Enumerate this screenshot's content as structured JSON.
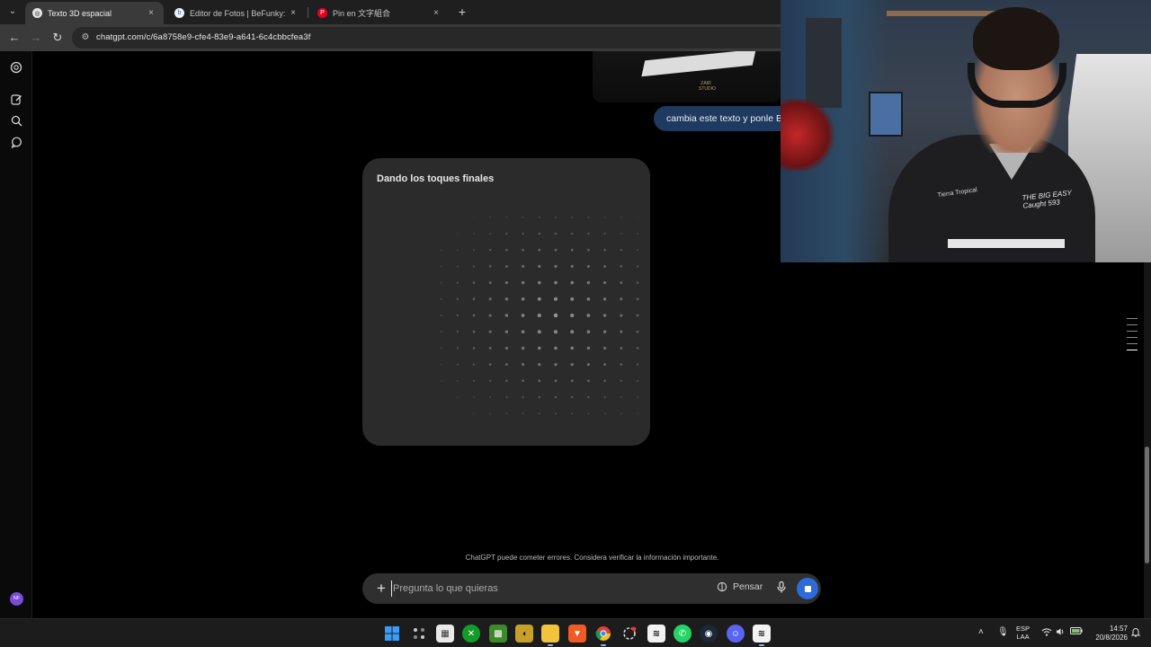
{
  "browser": {
    "tabs": [
      {
        "title": "Texto 3D espacial",
        "active": true,
        "icon": "chatgpt-icon"
      },
      {
        "title": "Editor de Fotos | BeFunky: Edita",
        "active": false,
        "icon": "befunky-icon"
      },
      {
        "title": "Pin en 文字組合",
        "active": false,
        "icon": "pinterest-icon"
      }
    ],
    "close_glyph": "×",
    "new_tab_glyph": "+",
    "url": "chatgpt.com/c/6a8758e9-cfe4-83e9-a641-6c4cbbcfea3f"
  },
  "chat": {
    "user_message": "cambia este texto y ponle B",
    "generating_status": "Dando los toques finales",
    "disclaimer": "ChatGPT puede cometer errores. Considera verificar la información importante.",
    "composer_placeholder": "Pregunta lo que quieras",
    "think_label": "Pensar",
    "preview_logo_text": "ZAIR STUDIO"
  },
  "sidebar": {
    "avatar_initials": "NF"
  },
  "webcam": {
    "shirt_text_1": "THE BIG EASY Caught 593",
    "shirt_text_2": "Tierra Tropical"
  },
  "taskbar": {
    "apps": [
      "windows-start-icon",
      "widgets-icon",
      "store-icon",
      "xbox-icon",
      "minecraft-icon",
      "among-us-icon",
      "file-explorer-icon",
      "brave-icon",
      "chrome-icon",
      "settings-icon",
      "capcut-icon",
      "whatsapp-icon",
      "steam-icon",
      "discord-icon",
      "capcut-icon-2"
    ],
    "language_line1": "ESP",
    "language_line2": "LAA",
    "time": "14:57",
    "date": "20/8/2026"
  }
}
